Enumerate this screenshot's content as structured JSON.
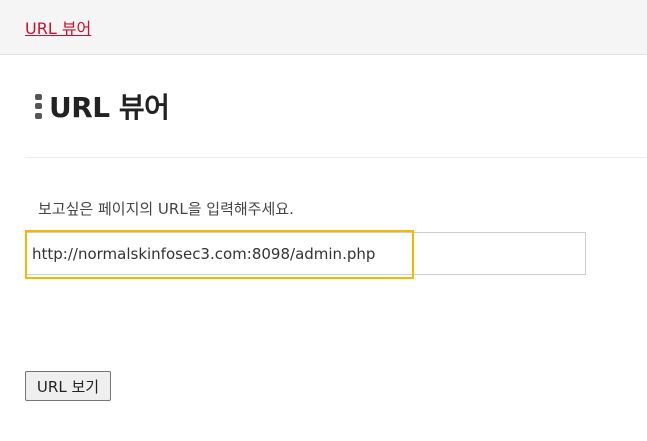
{
  "header": {
    "link_label": "URL 뷰어"
  },
  "main": {
    "title": "URL 뷰어",
    "instruction": "보고싶은 페이지의 URL을 입력해주세요.",
    "url_input": {
      "value": "http://normalskinfosec3.com:8098/admin.php",
      "placeholder": ""
    },
    "view_button_label": "URL 보기"
  },
  "colors": {
    "link": "#c8102e",
    "highlight": "#f5b800",
    "header_bg": "#f5f5f5"
  },
  "icons": {
    "title_icon": "vertical-dots-icon"
  }
}
